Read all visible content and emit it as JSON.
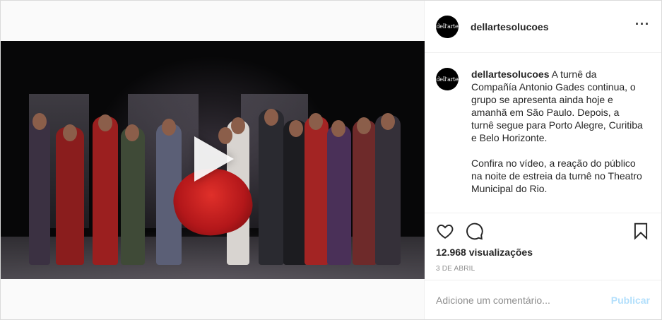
{
  "post": {
    "username": "dellartesolucoes",
    "avatar_text": "dell'arte",
    "more_icon": "more-horizontal-icon",
    "caption": {
      "username": "dellartesolucoes",
      "paragraph1": " A turnê da Compañía Antonio Gades continua, o grupo se apresenta ainda hoje e amanhã em São Paulo. Depois, a turnê segue para Porto Alegre, Curitiba e Belo Horizonte.",
      "paragraph2": "Confira no vídeo, a reação do público na noite de estreia da turnê no Theatro Municipal do Rio."
    },
    "views": "12.968 visualizações",
    "date": "3 DE ABRIL",
    "comment_placeholder": "Adicione um comentário...",
    "publish_label": "Publicar",
    "icons": {
      "like": "heart-icon",
      "comment": "comment-icon",
      "save": "bookmark-icon",
      "play": "play-icon"
    },
    "colors": {
      "publish_disabled": "#b2dffc",
      "secondary_text": "#8e8e8e",
      "dress": "#d62a26"
    }
  }
}
